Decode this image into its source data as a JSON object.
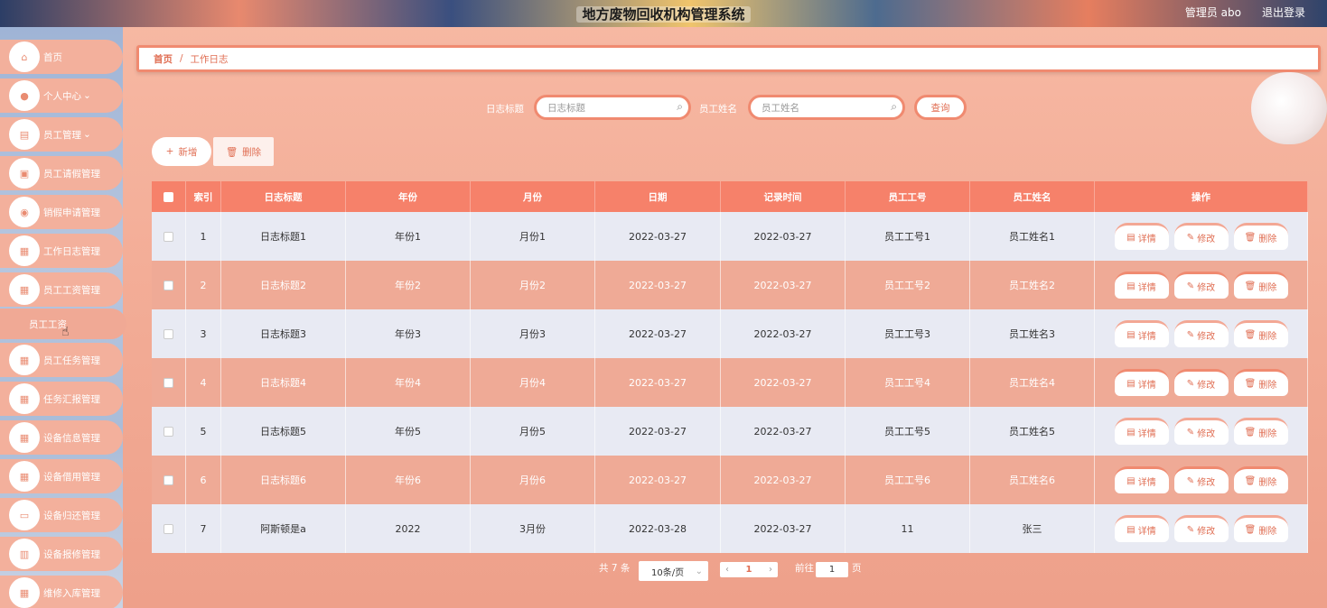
{
  "header": {
    "title": "地方废物回收机构管理系统",
    "user": "管理员 abo",
    "logout": "退出登录"
  },
  "sidebar": {
    "items": [
      {
        "label": "首页",
        "icon": "home-icon"
      },
      {
        "label": "个人中心",
        "icon": "user-icon"
      },
      {
        "label": "员工管理",
        "icon": "list-icon"
      },
      {
        "label": "员工请假管理",
        "icon": "briefcase-icon"
      },
      {
        "label": "销假申请管理",
        "icon": "pin-icon"
      },
      {
        "label": "工作日志管理",
        "icon": "doc-icon"
      },
      {
        "label": "员工工资管理",
        "icon": "grid-icon"
      },
      {
        "label": "员工任务管理",
        "icon": "doc-icon"
      },
      {
        "label": "任务汇报管理",
        "icon": "grid-icon"
      },
      {
        "label": "设备信息管理",
        "icon": "grid-icon"
      },
      {
        "label": "设备借用管理",
        "icon": "grid-icon"
      },
      {
        "label": "设备归还管理",
        "icon": "chat-icon"
      },
      {
        "label": "设备报修管理",
        "icon": "chart-icon"
      },
      {
        "label": "维修入库管理",
        "icon": "grid-icon"
      }
    ],
    "submenu_label": "员工工资"
  },
  "breadcrumb": {
    "home": "首页",
    "sep": "/",
    "current": "工作日志"
  },
  "search": {
    "title_label": "日志标题",
    "title_placeholder": "日志标题",
    "name_label": "员工姓名",
    "name_placeholder": "员工姓名",
    "query": "查询"
  },
  "actions": {
    "add": "新增",
    "delete": "删除"
  },
  "table": {
    "headers": [
      "索引",
      "日志标题",
      "年份",
      "月份",
      "日期",
      "记录时间",
      "员工工号",
      "员工姓名",
      "操作"
    ],
    "rows": [
      [
        "1",
        "日志标题1",
        "年份1",
        "月份1",
        "2022-03-27",
        "2022-03-27",
        "员工工号1",
        "员工姓名1"
      ],
      [
        "2",
        "日志标题2",
        "年份2",
        "月份2",
        "2022-03-27",
        "2022-03-27",
        "员工工号2",
        "员工姓名2"
      ],
      [
        "3",
        "日志标题3",
        "年份3",
        "月份3",
        "2022-03-27",
        "2022-03-27",
        "员工工号3",
        "员工姓名3"
      ],
      [
        "4",
        "日志标题4",
        "年份4",
        "月份4",
        "2022-03-27",
        "2022-03-27",
        "员工工号4",
        "员工姓名4"
      ],
      [
        "5",
        "日志标题5",
        "年份5",
        "月份5",
        "2022-03-27",
        "2022-03-27",
        "员工工号5",
        "员工姓名5"
      ],
      [
        "6",
        "日志标题6",
        "年份6",
        "月份6",
        "2022-03-27",
        "2022-03-27",
        "员工工号6",
        "员工姓名6"
      ],
      [
        "7",
        "阿斯顿是a",
        "2022",
        "3月份",
        "2022-03-28",
        "2022-03-27",
        "11",
        "张三"
      ]
    ],
    "op_labels": {
      "detail": "详情",
      "edit": "修改",
      "delete": "删除"
    }
  },
  "pagination": {
    "total": "共 7 条",
    "page_size": "10条/页",
    "current_page": "1",
    "goto_label": "前往",
    "goto_value": "1",
    "page_unit": "页"
  },
  "colors": {
    "accent": "#f6816a",
    "header_bg": "#f6816a",
    "text_accent": "#e06e53"
  }
}
